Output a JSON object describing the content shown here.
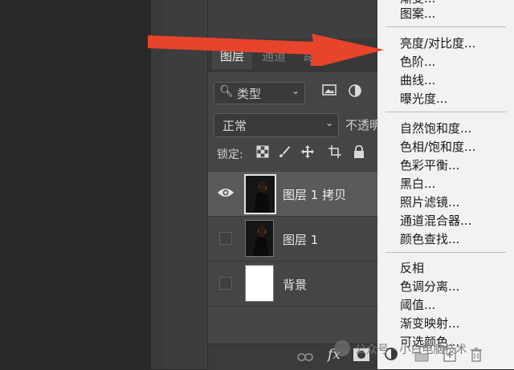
{
  "tabs": [
    "图层",
    "通道",
    "路径"
  ],
  "filter": {
    "label": "类型"
  },
  "blend": {
    "mode": "正常",
    "opacity_label": "不透明"
  },
  "lock": {
    "label": "锁定:"
  },
  "layers": [
    {
      "name": "图层 1 拷贝",
      "selected": true,
      "visible": true
    },
    {
      "name": "图层 1",
      "selected": false,
      "visible": false
    },
    {
      "name": "背景",
      "selected": false,
      "visible": false
    }
  ],
  "bottom_icons": [
    "link-icon",
    "fx-icon",
    "mask-icon",
    "adjustment-icon",
    "group-icon",
    "new-layer-icon",
    "trash-icon"
  ],
  "bottom": {
    "fx": "fx"
  },
  "menu": {
    "items_top": [
      "渐变...",
      "图案..."
    ],
    "group1": [
      "亮度/对比度...",
      "色阶...",
      "曲线...",
      "曝光度..."
    ],
    "group2": [
      "自然饱和度...",
      "色相/饱和度...",
      "色彩平衡...",
      "黑白...",
      "照片滤镜...",
      "通道混合器...",
      "颜色查找..."
    ],
    "group3": [
      "反相",
      "色调分离...",
      "阈值...",
      "渐变映射...",
      "可选颜色..."
    ]
  },
  "watermark": "公众号 · 小白电脑技术",
  "colors": {
    "arrow": "#e8432b",
    "menu_bg": "#f2f2f2",
    "panel_bg": "#454545"
  }
}
